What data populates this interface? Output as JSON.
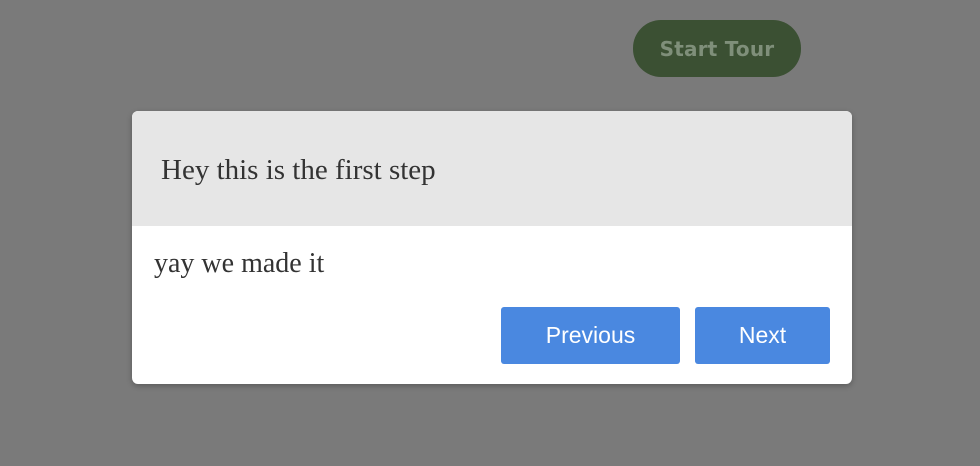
{
  "page": {
    "start_tour_label": "Start Tour"
  },
  "tour_step": {
    "title": "Hey this is the first step",
    "text": "yay we made it",
    "previous_label": "Previous",
    "next_label": "Next"
  },
  "colors": {
    "backdrop": "#7a7a7a",
    "start_tour_bg": "#3b5033",
    "header_bg": "#e6e6e6",
    "button_bg": "#4a88e0",
    "button_text": "#ffffff",
    "body_text": "#333333"
  }
}
